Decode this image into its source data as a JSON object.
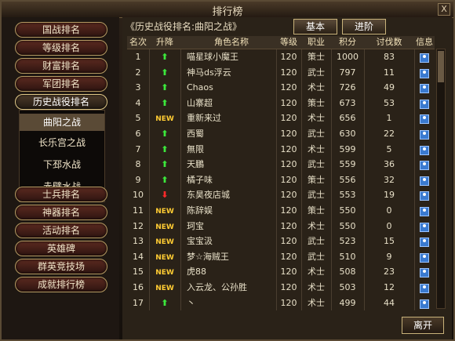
{
  "window": {
    "title": "排行榜",
    "close": "X"
  },
  "menu": {
    "items": [
      "国战排名",
      "等级排名",
      "财富排名",
      "军团排名",
      "历史战役排名",
      "士兵排名",
      "神器排名",
      "活动排名",
      "英雄碑",
      "群英竞技场",
      "成就排行榜"
    ],
    "submenu": [
      "曲阳之战",
      "长乐宫之战",
      "下邳水战",
      "赤壁水战"
    ]
  },
  "panel": {
    "header": "《历史战役排名:曲阳之战》",
    "btn_basic": "基本",
    "btn_advanced": "进阶",
    "leave": "离开"
  },
  "table": {
    "columns": [
      "名次",
      "升降",
      "角色名称",
      "等级",
      "职业",
      "积分",
      "讨伐数",
      "信息"
    ],
    "rows": [
      [
        "1",
        "up",
        "喵星球小魔王",
        "120",
        "策士",
        "1000",
        "83"
      ],
      [
        "2",
        "up",
        "神马ds浮云",
        "120",
        "武士",
        "797",
        "11"
      ],
      [
        "3",
        "up",
        "Chaos",
        "120",
        "术士",
        "726",
        "49"
      ],
      [
        "4",
        "up",
        "山寨超",
        "120",
        "策士",
        "673",
        "53"
      ],
      [
        "5",
        "new",
        "重新来过",
        "120",
        "术士",
        "656",
        "1"
      ],
      [
        "6",
        "up",
        "西蜀",
        "120",
        "武士",
        "630",
        "22"
      ],
      [
        "7",
        "up",
        "無限",
        "120",
        "术士",
        "599",
        "5"
      ],
      [
        "8",
        "up",
        "天鵬",
        "120",
        "武士",
        "559",
        "36"
      ],
      [
        "9",
        "up",
        "橘子味",
        "120",
        "策士",
        "556",
        "32"
      ],
      [
        "10",
        "down",
        "东昊夜店城",
        "120",
        "武士",
        "553",
        "19"
      ],
      [
        "11",
        "new",
        "陈辞娱",
        "120",
        "策士",
        "550",
        "0"
      ],
      [
        "12",
        "new",
        "珂宝",
        "120",
        "术士",
        "550",
        "0"
      ],
      [
        "13",
        "new",
        "宝宝汲",
        "120",
        "武士",
        "523",
        "15"
      ],
      [
        "14",
        "new",
        "梦☆海贼王",
        "120",
        "武士",
        "510",
        "9"
      ],
      [
        "15",
        "new",
        "虎88",
        "120",
        "术士",
        "508",
        "23"
      ],
      [
        "16",
        "new",
        "入云龙、公孙胜",
        "120",
        "术士",
        "503",
        "12"
      ],
      [
        "17",
        "up",
        "丶",
        "120",
        "术士",
        "499",
        "44"
      ]
    ]
  }
}
